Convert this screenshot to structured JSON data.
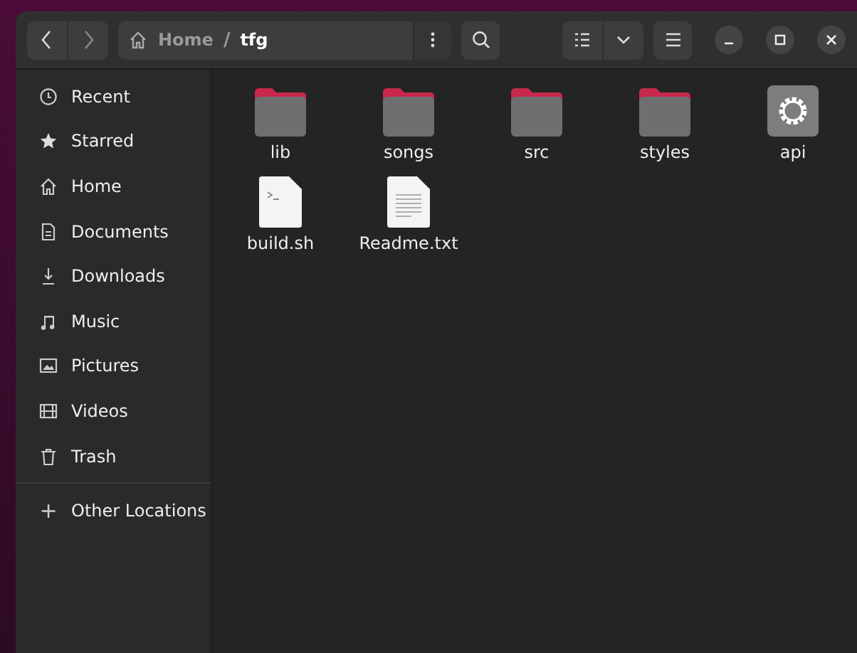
{
  "path": {
    "parts": [
      "Home",
      "tfg"
    ],
    "separator": "/"
  },
  "sidebar": {
    "items": [
      {
        "label": "Recent",
        "kind": "recent"
      },
      {
        "label": "Starred",
        "kind": "starred"
      },
      {
        "label": "Home",
        "kind": "home"
      },
      {
        "label": "Documents",
        "kind": "documents"
      },
      {
        "label": "Downloads",
        "kind": "downloads"
      },
      {
        "label": "Music",
        "kind": "music"
      },
      {
        "label": "Pictures",
        "kind": "pictures"
      },
      {
        "label": "Videos",
        "kind": "videos"
      },
      {
        "label": "Trash",
        "kind": "trash"
      }
    ],
    "other": {
      "label": "Other Locations",
      "symbol": "+"
    }
  },
  "files": [
    {
      "name": "lib",
      "kind": "folder"
    },
    {
      "name": "songs",
      "kind": "folder"
    },
    {
      "name": "src",
      "kind": "folder"
    },
    {
      "name": "styles",
      "kind": "folder"
    },
    {
      "name": "api",
      "kind": "executable"
    },
    {
      "name": "build.sh",
      "kind": "script"
    },
    {
      "name": "Readme.txt",
      "kind": "text"
    }
  ]
}
